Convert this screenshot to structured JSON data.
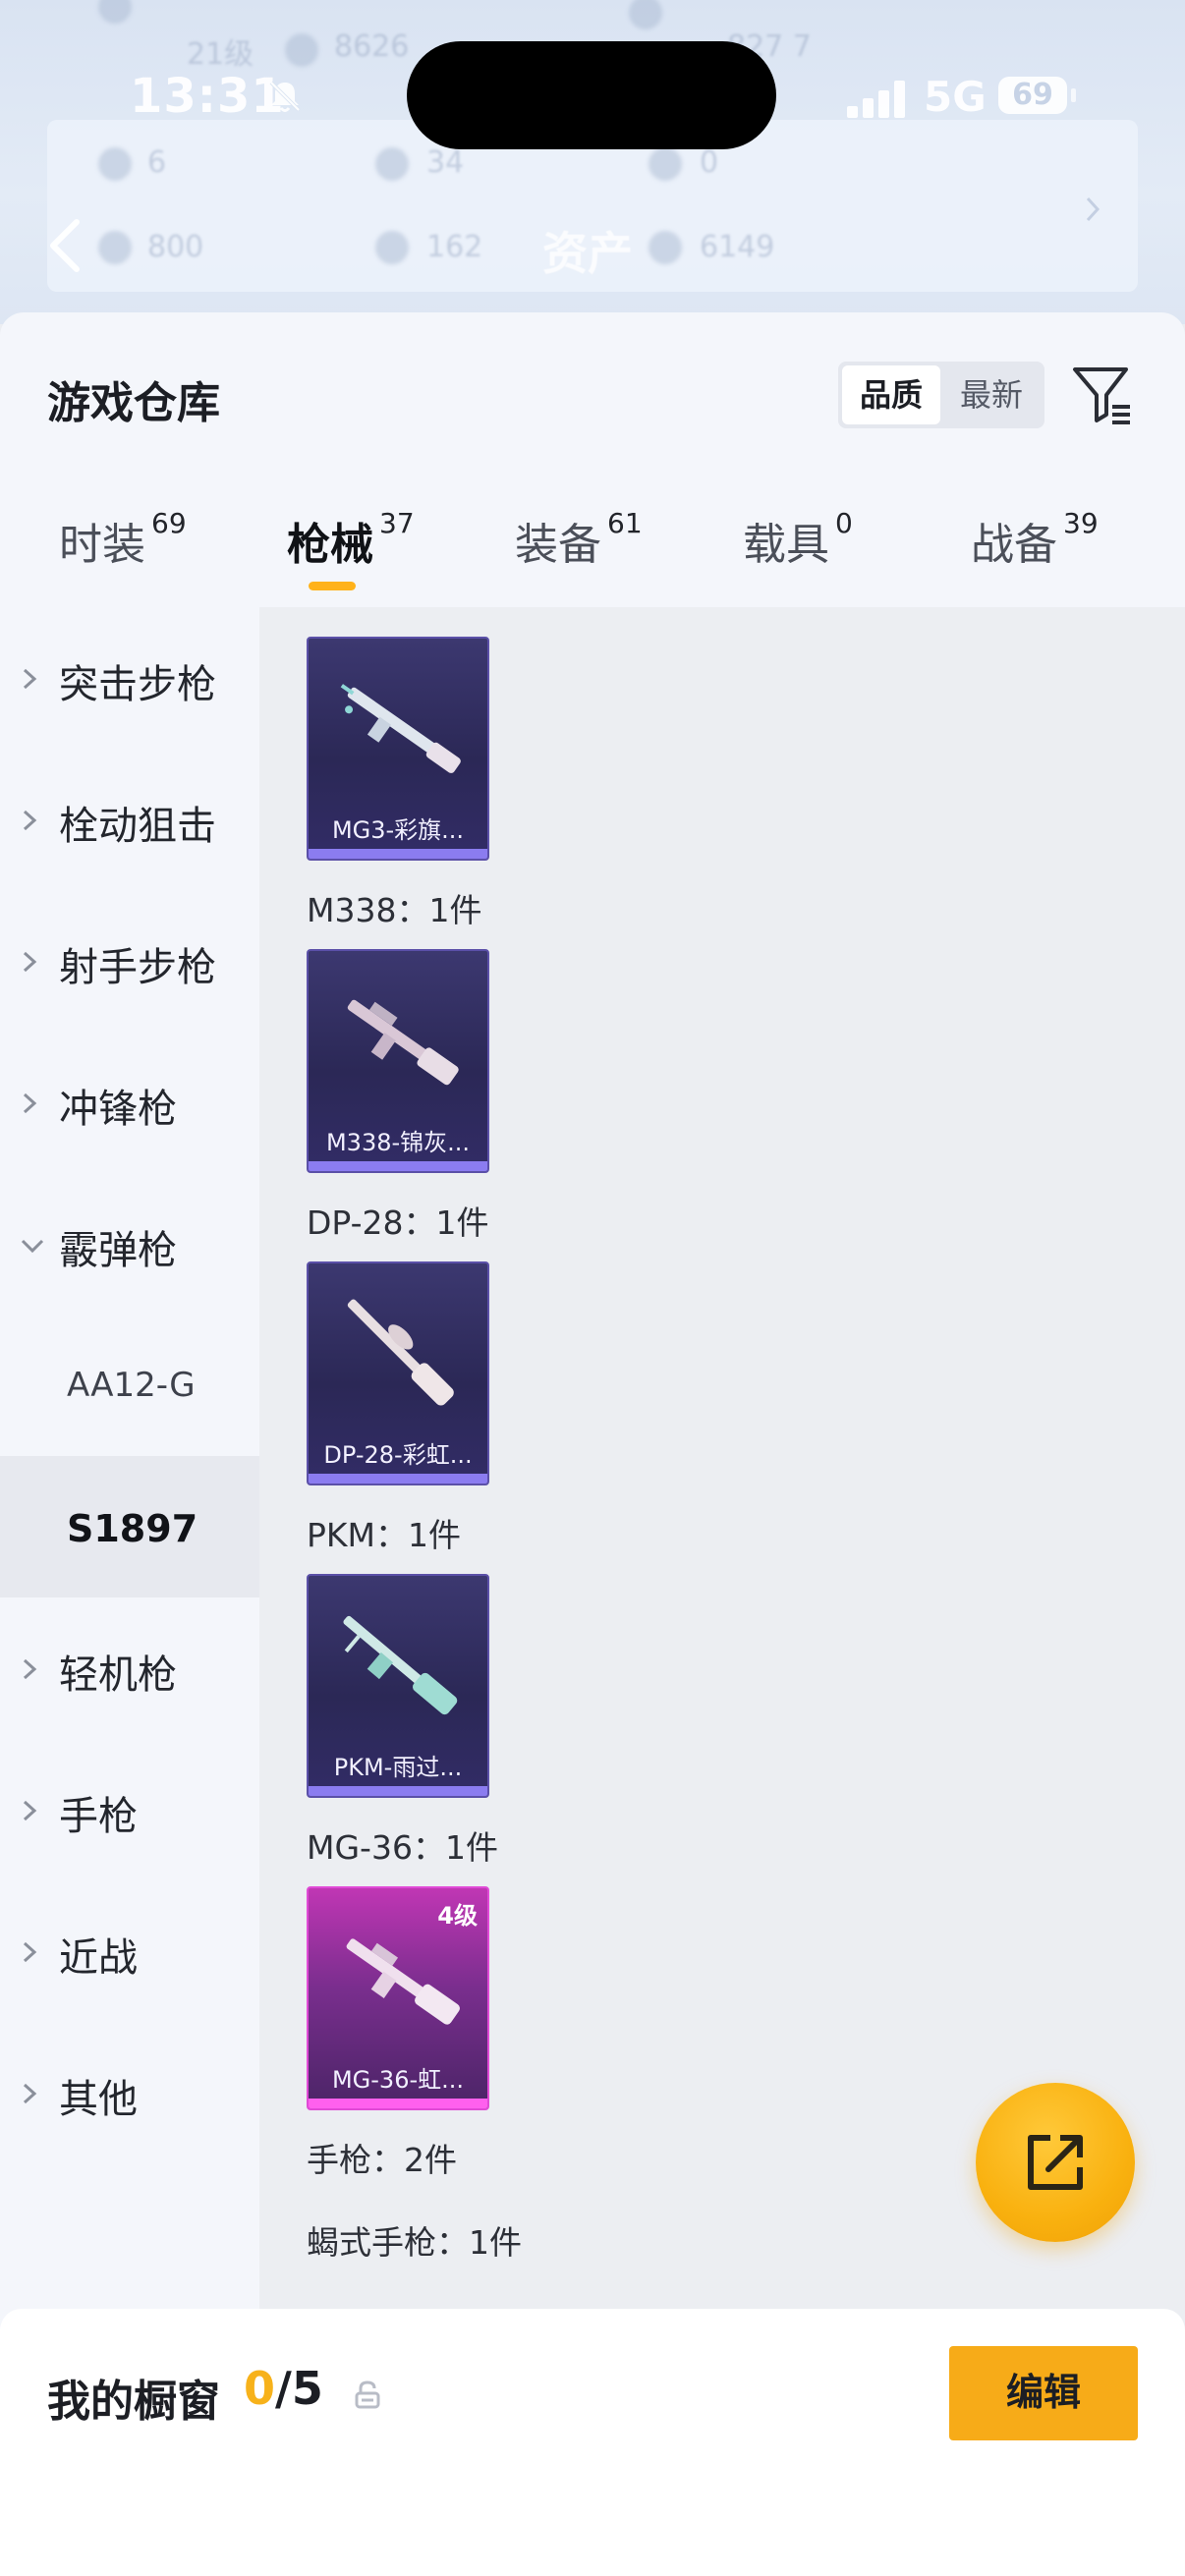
{
  "status_bar": {
    "time": "13:31",
    "network": "5G",
    "battery": "69"
  },
  "header": {
    "title": "资产"
  },
  "warehouse": {
    "title": "游戏仓库",
    "sort_options": [
      "品质",
      "最新"
    ],
    "sort_selected": "品质"
  },
  "tabs": [
    {
      "label": "时装",
      "count": "69"
    },
    {
      "label": "枪械",
      "count": "37"
    },
    {
      "label": "装备",
      "count": "61"
    },
    {
      "label": "载具",
      "count": "0"
    },
    {
      "label": "战备",
      "count": "39"
    }
  ],
  "active_tab": "枪械",
  "categories": [
    {
      "label": "突击步枪",
      "state": "collapsed"
    },
    {
      "label": "栓动狙击",
      "state": "collapsed"
    },
    {
      "label": "射手步枪",
      "state": "collapsed"
    },
    {
      "label": "冲锋枪",
      "state": "collapsed"
    },
    {
      "label": "霰弹枪",
      "state": "expanded"
    },
    {
      "label": "AA12-G",
      "state": "sub"
    },
    {
      "label": "S1897",
      "state": "sub-selected"
    },
    {
      "label": "轻机枪",
      "state": "collapsed"
    },
    {
      "label": "手枪",
      "state": "collapsed"
    },
    {
      "label": "近战",
      "state": "collapsed"
    },
    {
      "label": "其他",
      "state": "collapsed"
    }
  ],
  "items": [
    {
      "name": "MG3-彩旗...",
      "rarity": "purple",
      "label_after": "M338：1件"
    },
    {
      "name": "M338-锦灰...",
      "rarity": "purple",
      "label_after": "DP-28：1件"
    },
    {
      "name": "DP-28-彩虹...",
      "rarity": "purple",
      "label_after": "PKM：1件"
    },
    {
      "name": "PKM-雨过...",
      "rarity": "purple",
      "label_after": "MG-36：1件"
    },
    {
      "name": "MG-36-虹...",
      "rarity": "pink",
      "level": "4级",
      "label_after": "手枪：2件"
    }
  ],
  "extra_label": "蝎式手枪：1件",
  "showcase": {
    "label": "我的橱窗",
    "current": "0",
    "total": "/5",
    "edit_label": "编辑"
  },
  "colors": {
    "accent": "#f7ab18",
    "purple_rarity": "#8b7cf0",
    "pink_rarity": "#ff60ee"
  }
}
